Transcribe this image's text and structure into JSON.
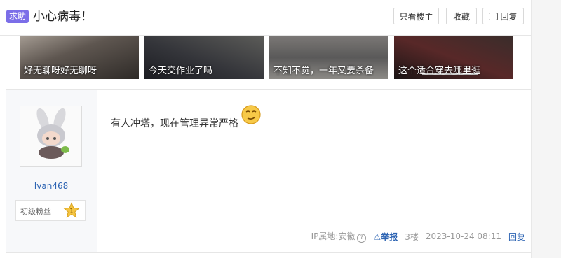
{
  "header": {
    "tag": "求助",
    "title": "小心病毒！",
    "buttons": {
      "only_op": "只看楼主",
      "favorite": "收藏",
      "reply": "回复"
    }
  },
  "thumbs": [
    {
      "caption": "好无聊呀好无聊呀"
    },
    {
      "caption": "今天交作业了吗"
    },
    {
      "caption": "不知不觉，一年又要杀备"
    },
    {
      "caption": "这个适合穿去哪里逛"
    }
  ],
  "post": {
    "author": {
      "name": "Ivan468",
      "fan_level_label": "初级粉丝",
      "fan_level": "1"
    },
    "content": "有人冲塔，现在管理异常严格",
    "footer": {
      "ip": "IP属地:安徽",
      "report": "举报",
      "floor": "3楼",
      "time": "2023-10-24 08:11",
      "reply": "回复"
    }
  },
  "colors": {
    "tag_bg": "#7b6ee8",
    "link": "#2d64b3"
  }
}
